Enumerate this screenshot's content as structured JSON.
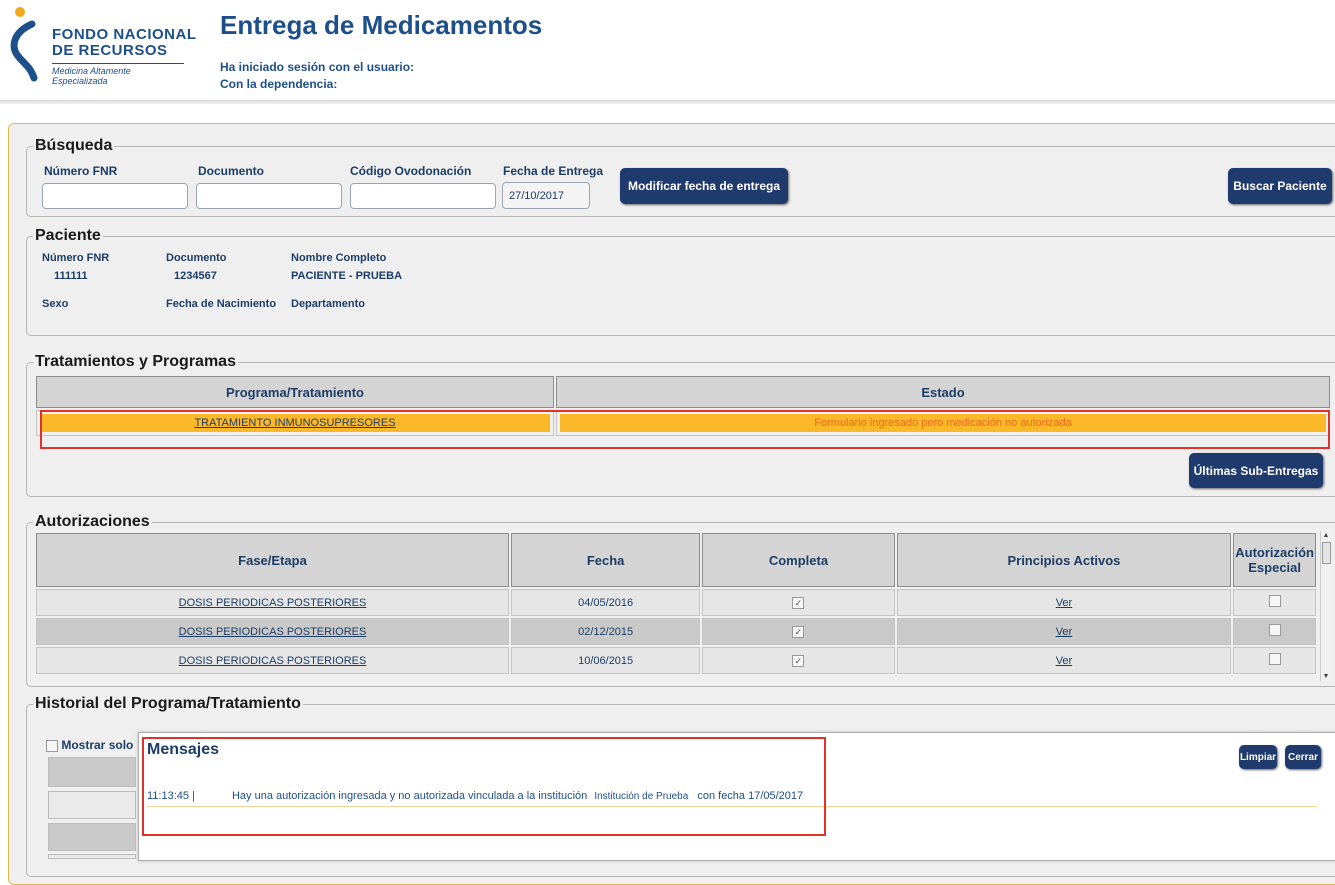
{
  "brand": {
    "line1": "FONDO NACIONAL",
    "line2": "DE RECURSOS",
    "tagline": "Medicina Altamente Especializada"
  },
  "header": {
    "title": "Entrega de Medicamentos",
    "user_label": "Ha iniciado sesión con el usuario:",
    "dependency_label": "Con la dependencia:"
  },
  "search": {
    "legend": "Búsqueda",
    "fnr_label": "Número FNR",
    "document_label": "Documento",
    "ovodonation_label": "Código Ovodonación",
    "delivery_date_label": "Fecha de Entrega",
    "delivery_date_value": "27/10/2017",
    "modify_date_button": "Modificar fecha de entrega",
    "search_button": "Buscar Paciente"
  },
  "patient": {
    "legend": "Paciente",
    "fnr_label": "Número FNR",
    "fnr_value": "111111",
    "document_label": "Documento",
    "document_value": "1234567",
    "name_label": "Nombre Completo",
    "name_value": "PACIENTE - PRUEBA",
    "sex_label": "Sexo",
    "birth_label": "Fecha de Nacimiento",
    "department_label": "Departamento"
  },
  "treatments": {
    "legend": "Tratamientos y Programas",
    "headers": [
      "Programa/Tratamiento",
      "Estado"
    ],
    "rows": [
      {
        "program": "TRATAMIENTO INMUNOSUPRESORES",
        "status": "Formulario ingresado pero medicación no autorizada"
      }
    ],
    "last_subdeliveries_button": "Últimas Sub-Entregas",
    "row_color": "#fbb829",
    "status_text_color": "#f26a1b"
  },
  "authorizations": {
    "legend": "Autorizaciones",
    "headers": [
      "Fase/Etapa",
      "Fecha",
      "Completa",
      "Principios Activos",
      "Autorización Especial"
    ],
    "rows": [
      {
        "phase": "DOSIS PERIODICAS POSTERIORES",
        "date": "04/05/2016",
        "complete": true,
        "link": "Ver",
        "special": false
      },
      {
        "phase": "DOSIS PERIODICAS POSTERIORES",
        "date": "02/12/2015",
        "complete": true,
        "link": "Ver",
        "special": false
      },
      {
        "phase": "DOSIS PERIODICAS POSTERIORES",
        "date": "10/06/2015",
        "complete": true,
        "link": "Ver",
        "special": false
      }
    ]
  },
  "history": {
    "legend": "Historial del Programa/Tratamiento",
    "show_only_label": "Mostrar solo"
  },
  "messages": {
    "title": "Mensajes",
    "clear_button": "Limpiar",
    "close_button": "Cerrar",
    "items": [
      {
        "time": "11:13:45 |",
        "text": "Hay una autorización ingresada y no autorizada vinculada a la institución",
        "institution": "Institución de Prueba",
        "suffix": "con fecha 17/05/2017"
      }
    ]
  },
  "colors": {
    "brand_blue": "#1d4f8a",
    "button_navy": "#1f3a6d",
    "highlight_red": "#e0312b"
  }
}
